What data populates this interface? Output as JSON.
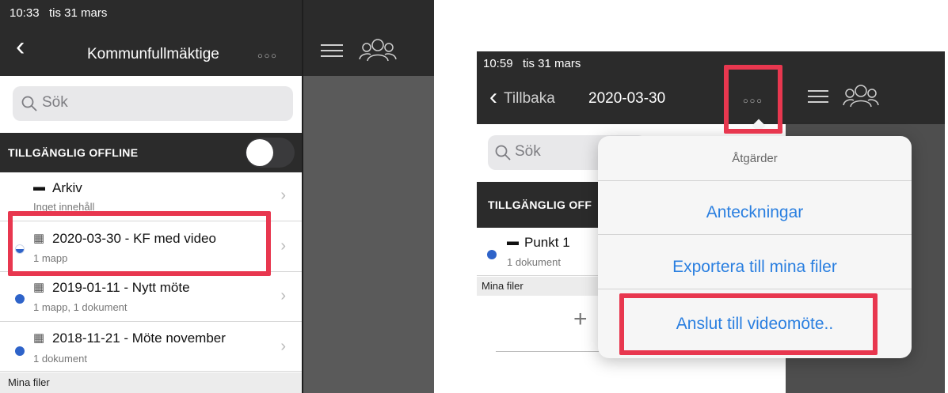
{
  "left": {
    "status_time": "10:33",
    "status_date": "tis 31 mars",
    "back_glyph": "‹",
    "title": "Kommunfullmäktige",
    "more_glyph": "○○○",
    "search_icon_glyph": "🔍",
    "search_placeholder": "Sök",
    "offline_label": "TILLGÄNGLIG OFFLINE",
    "rows": [
      {
        "icon": "▬",
        "title": "Arkiv",
        "subtitle": "Inget innehåll"
      },
      {
        "icon": "▦",
        "title": "2020-03-30 - KF med video",
        "subtitle": "1 mapp"
      },
      {
        "icon": "▦",
        "title": "2019-01-11 - Nytt möte",
        "subtitle": "1 mapp, 1 dokument"
      },
      {
        "icon": "▦",
        "title": "2018-11-21 - Möte november",
        "subtitle": "1 dokument"
      }
    ],
    "section_label": "Mina filer",
    "chevron": "›"
  },
  "right": {
    "status_time": "10:59",
    "status_date": "tis 31 mars",
    "back_label": "Tillbaka",
    "date_title": "2020-03-30",
    "more_glyph": "○○○",
    "search_placeholder": "Sök",
    "offline_label": "TILLGÄNGLIG OFF",
    "row_icon": "▬",
    "row_title": "Punkt 1",
    "row_subtitle": "1 dokument",
    "section_label": "Mina filer",
    "add_glyph": "+",
    "popover": {
      "title": "Åtgärder",
      "items": [
        "Anteckningar",
        "Exportera till mina filer",
        "Anslut till videomöte.."
      ]
    }
  },
  "colors": {
    "bar": "#2b2b2b",
    "highlight": "#e8374f",
    "accent": "#2a7fe0",
    "unread_dot": "#2e63c9"
  },
  "icons": [
    "back-chevron-icon",
    "more-options-icon",
    "menu-icon",
    "participants-icon",
    "search-icon",
    "archive-icon",
    "calendar-icon",
    "chevron-right-icon",
    "add-icon"
  ]
}
